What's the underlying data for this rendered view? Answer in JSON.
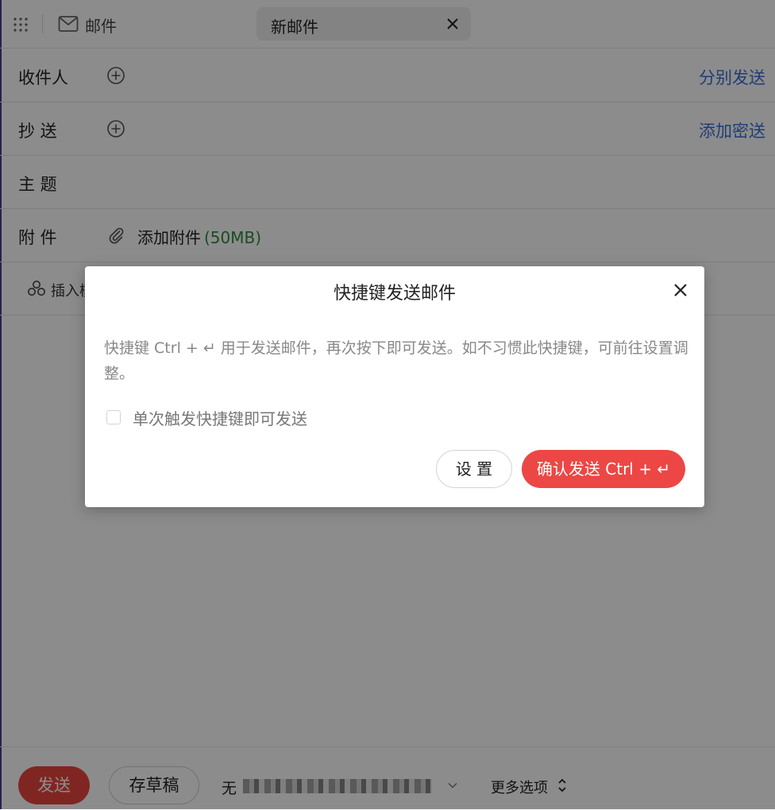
{
  "topbar": {
    "app_title": "邮件",
    "tab_label": "新邮件"
  },
  "form": {
    "to_label": "收件人",
    "to_link": "分别发送",
    "cc_label": "抄 送",
    "cc_link": "添加密送",
    "subject_label": "主 题",
    "attach_label": "附 件",
    "attach_text": "添加附件",
    "attach_size": "(50MB)"
  },
  "toolbar": {
    "insert_label": "插入模"
  },
  "bottombar": {
    "send_label": "发送",
    "draft_label": "存草稿",
    "from_label": "无",
    "more_label": "更多选项"
  },
  "modal": {
    "title": "快捷键发送邮件",
    "body": "快捷键 Ctrl + ↵ 用于发送邮件，再次按下即可发送。如不习惯此快捷键，可前往设置调整。",
    "checkbox_label": "单次触发快捷键即可发送",
    "checkbox_checked": false,
    "settings_button": "设 置",
    "confirm_button": "确认发送 Ctrl + ↵"
  },
  "colors": {
    "accent_red": "#ec4745",
    "link_blue": "#3b6fd4",
    "size_green": "#2f8a3c"
  }
}
